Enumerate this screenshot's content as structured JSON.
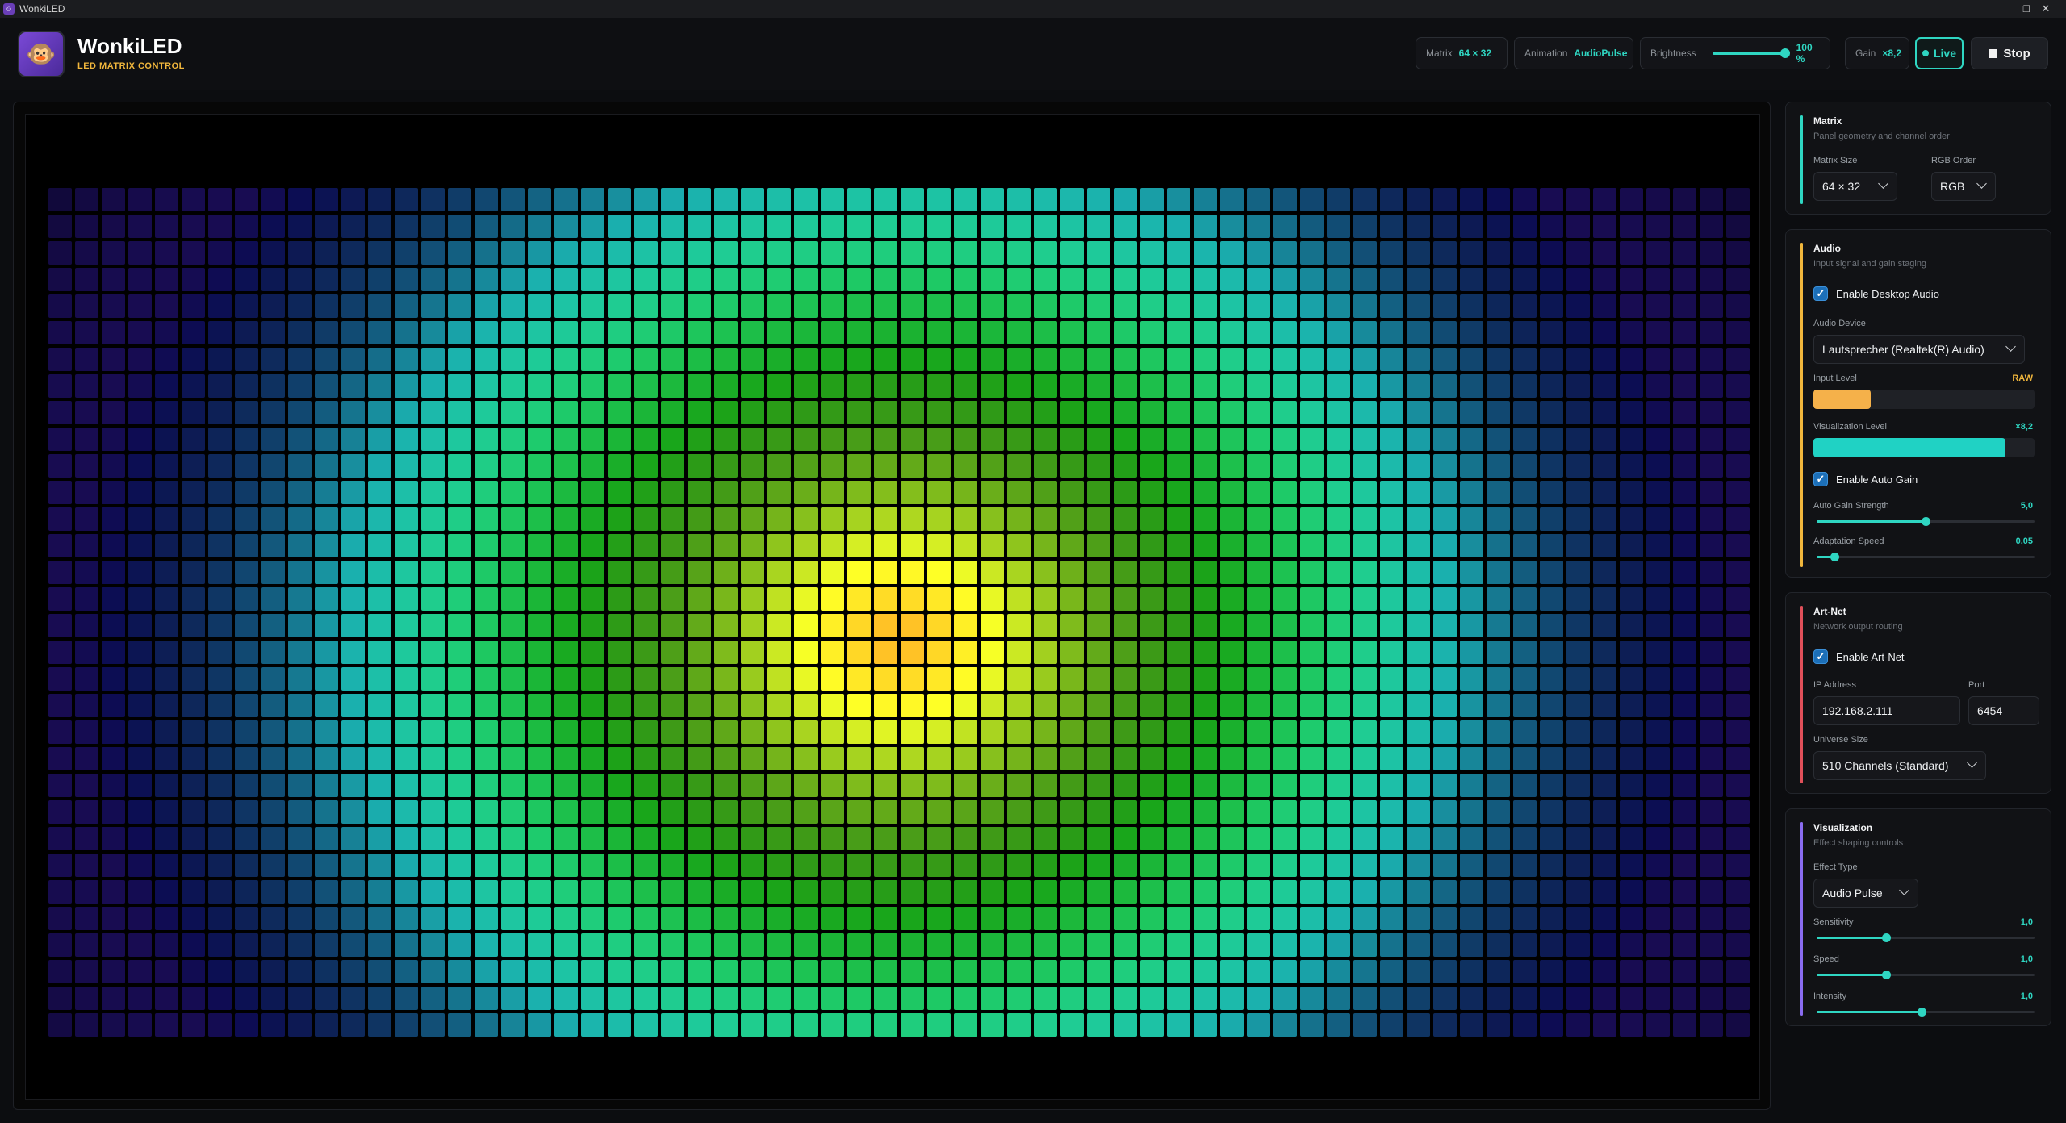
{
  "window": {
    "title": "WonkiLED",
    "controls": [
      "minimize",
      "restore",
      "close"
    ]
  },
  "header": {
    "brand_name": "WonkiLED",
    "brand_subtitle": "LED MATRIX CONTROL",
    "matrix": {
      "label": "Matrix",
      "value": "64 × 32"
    },
    "animation": {
      "label": "Animation",
      "value": "AudioPulse"
    },
    "brightness": {
      "label": "Brightness",
      "value": "100 %",
      "level": 1.0
    },
    "gain": {
      "label": "Gain",
      "value": "×8,2"
    },
    "live_label": "Live",
    "stop_label": "Stop"
  },
  "matrix_view": {
    "columns": 64,
    "rows": 32,
    "effect": "Audio Pulse"
  },
  "panels": {
    "matrix": {
      "title": "Matrix",
      "subtitle": "Panel geometry and channel order",
      "size_label": "Matrix Size",
      "size_value": "64 × 32",
      "rgb_label": "RGB Order",
      "rgb_value": "RGB"
    },
    "audio": {
      "title": "Audio",
      "subtitle": "Input signal and gain staging",
      "enable_label": "Enable Desktop Audio",
      "enable_checked": true,
      "device_label": "Audio Device",
      "device_value": "Lautsprecher (Realtek(R) Audio)",
      "input_level_label": "Input Level",
      "input_level_tag": "RAW",
      "input_level": 0.26,
      "viz_level_label": "Visualization Level",
      "viz_level_tag": "×8,2",
      "viz_level": 0.87,
      "auto_gain_label": "Enable Auto Gain",
      "auto_gain_checked": true,
      "strength_label": "Auto Gain Strength",
      "strength_value": "5,0",
      "strength_level": 0.5,
      "adapt_label": "Adaptation Speed",
      "adapt_value": "0,05",
      "adapt_level": 0.08
    },
    "artnet": {
      "title": "Art-Net",
      "subtitle": "Network output routing",
      "enable_label": "Enable Art-Net",
      "enable_checked": true,
      "ip_label": "IP Address",
      "ip_value": "192.168.2.111",
      "port_label": "Port",
      "port_value": "6454",
      "universe_label": "Universe Size",
      "universe_value": "510 Channels (Standard)"
    },
    "visualization": {
      "title": "Visualization",
      "subtitle": "Effect shaping controls",
      "effect_label": "Effect Type",
      "effect_value": "Audio Pulse",
      "sensitivity_label": "Sensitivity",
      "sensitivity_value": "1,0",
      "sensitivity_level": 0.32,
      "speed_label": "Speed",
      "speed_value": "1,0",
      "speed_level": 0.32,
      "intensity_label": "Intensity",
      "intensity_value": "1,0",
      "intensity_level": 0.48
    }
  },
  "colors": {
    "accent_teal": "#2fd6c2",
    "accent_gold": "#f0b63c",
    "matrix_accent": "#2fd6c2",
    "audio_accent": "#f0b63c",
    "artnet_accent": "#e0505a",
    "visualization_accent": "#8a6cf0"
  }
}
